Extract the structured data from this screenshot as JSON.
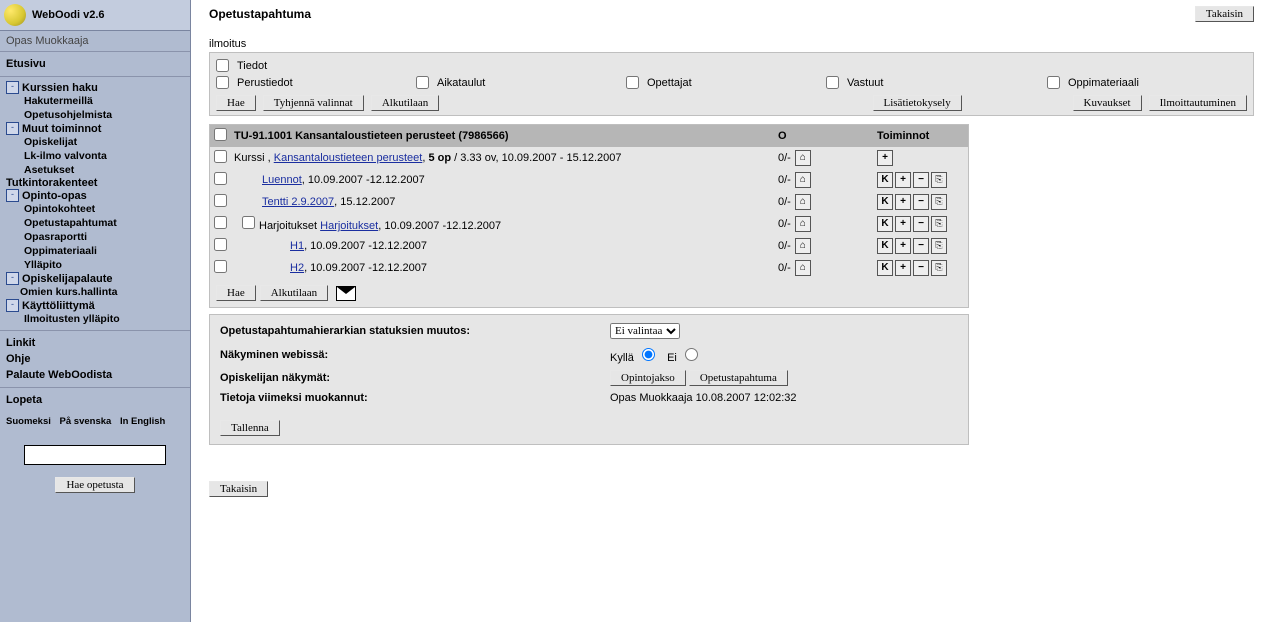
{
  "app": {
    "title": "WebOodi v2.6",
    "subuser": "Opas Muokkaaja"
  },
  "sidebar": {
    "etusivu": "Etusivu",
    "groups": [
      {
        "head": "Kurssien haku",
        "items": [
          "Hakutermeillä",
          "Opetusohjelmista"
        ]
      },
      {
        "head": "Muut toiminnot",
        "items": [
          "Opiskelijat",
          "Lk-ilmo valvonta",
          "Asetukset"
        ]
      }
    ],
    "tutk": "Tutkintorakenteet",
    "opinto": {
      "head": "Opinto-opas",
      "items": [
        "Opintokohteet",
        "Opetustapahtumat",
        "Opasraportti",
        "Oppimateriaali",
        "Ylläpito"
      ]
    },
    "palaute": {
      "head": "Opiskelijapalaute",
      "sub": "Omien kurs.hallinta"
    },
    "kaytto": {
      "head": "Käyttöliittymä",
      "items": [
        "Ilmoitusten ylläpito"
      ]
    },
    "links": [
      "Linkit",
      "Ohje",
      "Palaute WebOodista"
    ],
    "lopeta": "Lopeta",
    "lang": [
      "Suomeksi",
      "På svenska",
      "In English"
    ],
    "searchbtn": "Hae opetusta"
  },
  "page": {
    "title": "Opetustapahtuma",
    "back": "Takaisin",
    "ilmoitus": "ilmoitus"
  },
  "filters": {
    "tiedot": "Tiedot",
    "perustiedot": "Perustiedot",
    "aikataulut": "Aikataulut",
    "opettajat": "Opettajat",
    "vastuut": "Vastuut",
    "oppimateriaali": "Oppimateriaali",
    "hae": "Hae",
    "tyhjenna": "Tyhjennä valinnat",
    "alkutilaan": "Alkutilaan",
    "lisatieto": "Lisätietokysely",
    "kuvaukset": "Kuvaukset",
    "ilmoitt": "Ilmoittautuminen"
  },
  "table": {
    "headA": "",
    "headB": "TU-91.1001 Kansantaloustieteen perusteet (7986566)",
    "headC": "O",
    "headD": "Toiminnot",
    "rows": [
      {
        "indent": 0,
        "chk2": false,
        "pre": "Kurssi , ",
        "link": "Kansantaloustieteen perusteet",
        "post": ", 5 op / 3.33 ov, 10.09.2007 - 15.12.2007",
        "o": "0/-",
        "actions": [
          "+"
        ]
      },
      {
        "indent": 1,
        "chk2": false,
        "pre": "",
        "link": "Luennot",
        "post": ", 10.09.2007 -12.12.2007",
        "o": "0/-",
        "actions": [
          "K",
          "+",
          "-",
          "copy"
        ]
      },
      {
        "indent": 1,
        "chk2": false,
        "pre": "",
        "link": "Tentti 2.9.2007",
        "post": ", 15.12.2007",
        "o": "0/-",
        "actions": [
          "K",
          "+",
          "-",
          "copy"
        ]
      },
      {
        "indent": 1,
        "chk2": true,
        "pre": "Harjoitukset ",
        "link": "Harjoitukset",
        "post": ", 10.09.2007 -12.12.2007",
        "o": "0/-",
        "actions": [
          "K",
          "+",
          "-",
          "copy"
        ]
      },
      {
        "indent": 2,
        "chk2": false,
        "pre": "",
        "link": "H1",
        "post": ", 10.09.2007 -12.12.2007",
        "o": "0/-",
        "actions": [
          "K",
          "+",
          "-",
          "copy"
        ]
      },
      {
        "indent": 2,
        "chk2": false,
        "pre": "",
        "link": "H2",
        "post": ", 10.09.2007 -12.12.2007",
        "o": "0/-",
        "actions": [
          "K",
          "+",
          "-",
          "copy"
        ]
      }
    ],
    "hae": "Hae",
    "alkutilaan": "Alkutilaan"
  },
  "status": {
    "l1": "Opetustapahtumahierarkian statuksien muutos:",
    "select": "Ei valintaa",
    "l2": "Näkyminen webissä:",
    "yes": "Kyllä",
    "no": "Ei",
    "l3": "Opiskelijan näkymät:",
    "b1": "Opintojakso",
    "b2": "Opetustapahtuma",
    "l4": "Tietoja viimeksi muokannut:",
    "l4v": "Opas Muokkaaja 10.08.2007 12:02:32",
    "save": "Tallenna"
  },
  "back2": "Takaisin"
}
